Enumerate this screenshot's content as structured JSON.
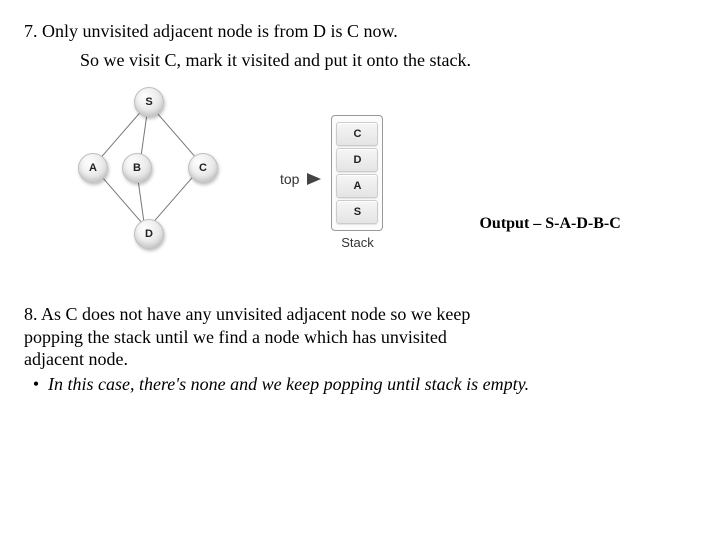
{
  "step7": {
    "line1": "7. Only unvisited adjacent node is from D is C now.",
    "line2": "So we visit C, mark it visited and put it onto the stack."
  },
  "graph": {
    "nodes": {
      "S": "S",
      "A": "A",
      "B": "B",
      "C": "C",
      "D": "D"
    }
  },
  "stack": {
    "topLabel": "top",
    "items": [
      "C",
      "D",
      "A",
      "S"
    ],
    "caption": "Stack"
  },
  "output": "Output – S-A-D-B-C",
  "step8": {
    "line1": "8. As C does not have any unvisited adjacent node so we keep",
    "line2": "popping the stack until we find a node which has unvisited",
    "line3": "adjacent node.",
    "bullet": "In this case, there's none and we keep popping until stack is empty."
  }
}
